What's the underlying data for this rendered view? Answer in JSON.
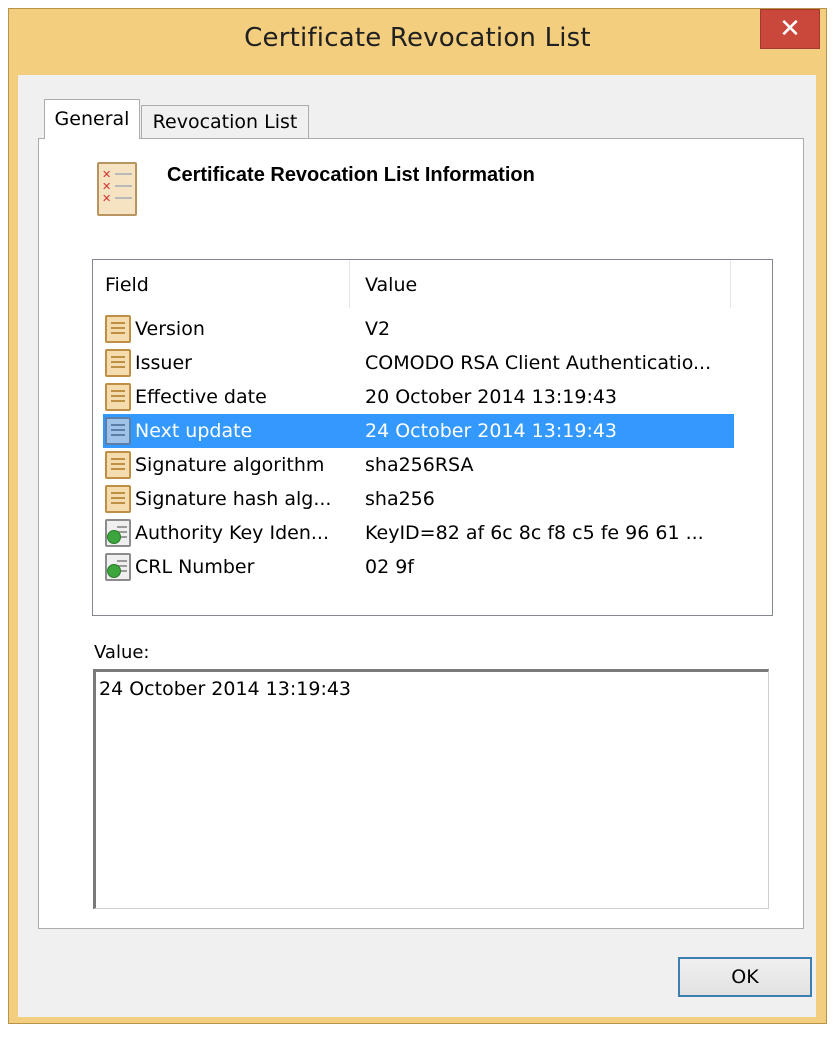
{
  "window": {
    "title": "Certificate Revocation List",
    "close_glyph": "✕"
  },
  "tabs": [
    {
      "label": "General",
      "selected": true
    },
    {
      "label": "Revocation List",
      "selected": false
    }
  ],
  "info": {
    "title": "Certificate Revocation List Information",
    "icon": "crl-document-icon"
  },
  "list": {
    "headers": {
      "field": "Field",
      "value": "Value"
    },
    "rows": [
      {
        "field": "Version",
        "value": "V2",
        "icon": "property-icon",
        "selected": false
      },
      {
        "field": "Issuer",
        "value": "COMODO RSA Client Authenticatio...",
        "icon": "property-icon",
        "selected": false
      },
      {
        "field": "Effective date",
        "value": "20 October 2014 13:19:43",
        "icon": "property-icon",
        "selected": false
      },
      {
        "field": "Next update",
        "value": "24 October 2014 13:19:43",
        "icon": "property-icon",
        "selected": true
      },
      {
        "field": "Signature algorithm",
        "value": "sha256RSA",
        "icon": "property-icon",
        "selected": false
      },
      {
        "field": "Signature hash alg...",
        "value": "sha256",
        "icon": "property-icon",
        "selected": false
      },
      {
        "field": "Authority Key Iden...",
        "value": "KeyID=82 af 6c 8c f8 c5 fe 96 61 ...",
        "icon": "extension-icon",
        "selected": false
      },
      {
        "field": "CRL Number",
        "value": "02 9f",
        "icon": "extension-icon",
        "selected": false
      }
    ]
  },
  "value_section": {
    "label": "Value:",
    "content": "24 October 2014 13:19:43"
  },
  "buttons": {
    "ok": "OK"
  },
  "colors": {
    "frame": "#f3ce7e",
    "close": "#c9483b",
    "selection": "#3399ff"
  }
}
